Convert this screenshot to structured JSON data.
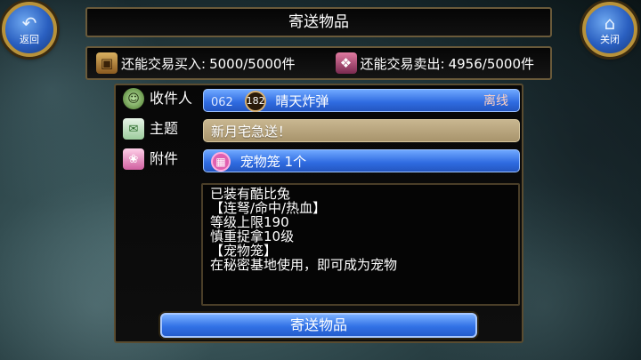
{
  "nav": {
    "back_label": "返回",
    "close_label": "关闭"
  },
  "title": "寄送物品",
  "quota": {
    "buy_label": "还能交易买入:",
    "buy_value": "5000/5000件",
    "sell_label": "还能交易卖出:",
    "sell_value": "4956/5000件"
  },
  "form": {
    "recipient": {
      "label": "收件人",
      "id": "062",
      "level": "182",
      "name": "晴天炸弹",
      "status": "离线"
    },
    "subject": {
      "label": "主题",
      "value": "新月宅急送！"
    },
    "attachment": {
      "label": "附件",
      "item": "宠物笼  1个"
    },
    "description": [
      "已装有酷比兔",
      "【连弩/命中/热血】",
      "等级上限190",
      "慎重捉拿10级",
      "【宠物笼】",
      "在秘密基地使用，即可成为宠物"
    ]
  },
  "send_button_label": "寄送物品",
  "colors": {
    "accent_blue": "#2e6ae0",
    "frame_gold": "#b8923a",
    "subject_field": "#b8a47c"
  }
}
